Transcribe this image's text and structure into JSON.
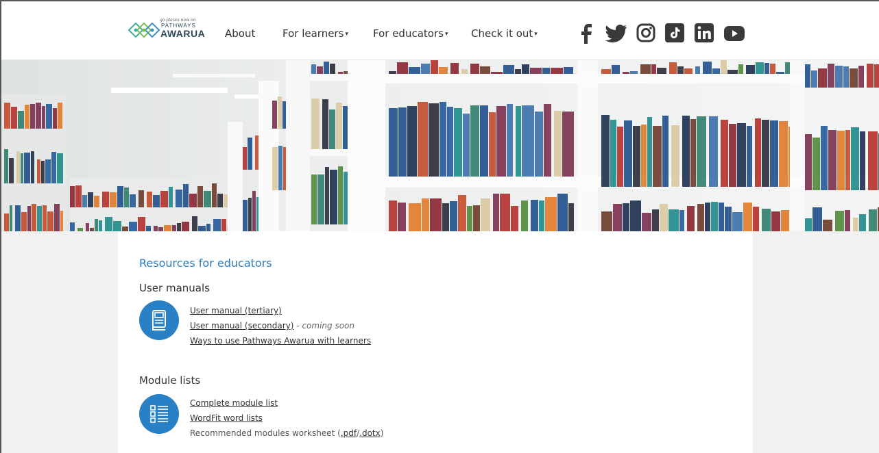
{
  "logo": {
    "tagline": "go places now on",
    "line1": "PATHWAYS",
    "line2": "AWARUA"
  },
  "nav": {
    "about": "About",
    "learners": "For learners",
    "educators": "For educators",
    "checkitout": "Check it out",
    "caret": "▾"
  },
  "social": [
    "facebook-icon",
    "twitter-icon",
    "instagram-icon",
    "tiktok-icon",
    "linkedin-icon",
    "youtube-icon"
  ],
  "colors": {
    "accent": "#2d7cb8",
    "icon_bg": "#2980c4",
    "social": "#3a3a3a"
  },
  "main": {
    "title": "Resources for educators",
    "user_manuals": {
      "heading": "User manuals",
      "icon": "book-icon",
      "link1": "User manual (tertiary)",
      "link2": "User manual (secondary)",
      "link2_suffix_dash": " - ",
      "link2_suffix": "coming soon",
      "link3": "Ways to use Pathways Awarua with learners"
    },
    "module_lists": {
      "heading": "Module lists",
      "icon": "list-icon",
      "link1": "Complete module list",
      "link2": "WordFit word lists",
      "worksheet_text": "Recommended modules worksheet (",
      "pdf": ".pdf",
      "slash": "/",
      "dotx": ".dotx",
      "close": ")"
    }
  }
}
